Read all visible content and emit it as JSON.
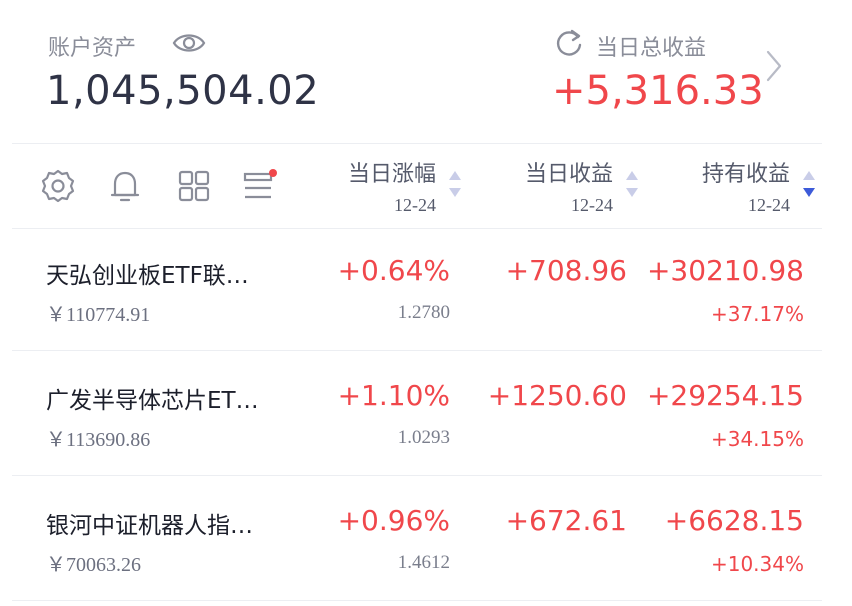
{
  "header": {
    "asset_label": "账户资产",
    "asset_value": "1,045,504.02",
    "daily_total_label": "当日总收益",
    "daily_total_value": "+5,316.33"
  },
  "toolbar": {
    "icons": [
      "gear-icon",
      "bell-icon",
      "grid-icon",
      "list-menu-icon"
    ],
    "notification_dot_color": "#f0474b"
  },
  "columns": [
    {
      "title": "当日涨幅",
      "date": "12-24",
      "sort": "none"
    },
    {
      "title": "当日收益",
      "date": "12-24",
      "sort": "none"
    },
    {
      "title": "持有收益",
      "date": "12-24",
      "sort": "descending"
    }
  ],
  "funds": [
    {
      "name": "天弘创业板ETF联…",
      "amount": "￥110774.91",
      "change_pct": "+0.64%",
      "nav": "1.2780",
      "daily_profit": "+708.96",
      "hold_profit": "+30210.98",
      "hold_rate": "+37.17%"
    },
    {
      "name": "广发半导体芯片ET…",
      "amount": "￥113690.86",
      "change_pct": "+1.10%",
      "nav": "1.0293",
      "daily_profit": "+1250.60",
      "hold_profit": "+29254.15",
      "hold_rate": "+34.15%"
    },
    {
      "name": "银河中证机器人指…",
      "amount": "￥70063.26",
      "change_pct": "+0.96%",
      "nav": "1.4612",
      "daily_profit": "+672.61",
      "hold_profit": "+6628.15",
      "hold_rate": "+10.34%"
    }
  ],
  "colors": {
    "positive": "#f0474b",
    "sort_active": "#3d5bd9",
    "sort_inactive": "#c9cde8"
  }
}
